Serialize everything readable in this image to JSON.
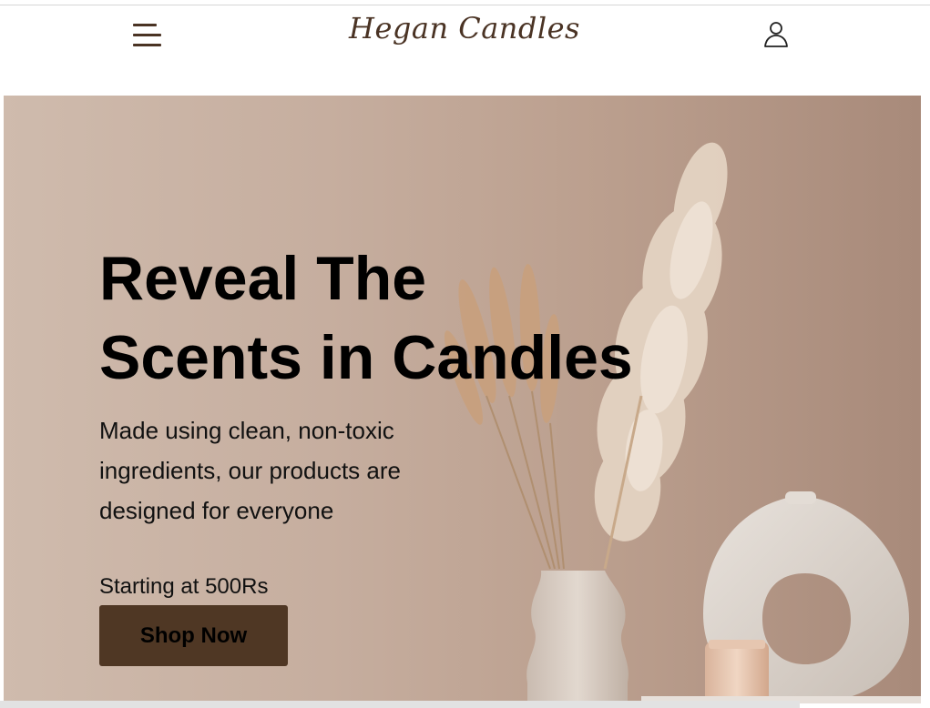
{
  "header": {
    "brand": "Hegan Candles",
    "menu_icon": "hamburger-menu-icon",
    "account_icon": "user-account-icon"
  },
  "hero": {
    "title_line1": "Reveal The",
    "title_line2": "Scents in Candles",
    "description": "Made using clean, non-toxic ingredients, our products are designed for everyone",
    "price_text": "Starting at 500Rs",
    "cta_label": "Shop Now",
    "image_description_icon": "pampas-grass-vases-image"
  },
  "colors": {
    "brand_brown": "#4a3324",
    "button_bg": "#4f3724",
    "hero_bg": "#c6ae9f"
  }
}
